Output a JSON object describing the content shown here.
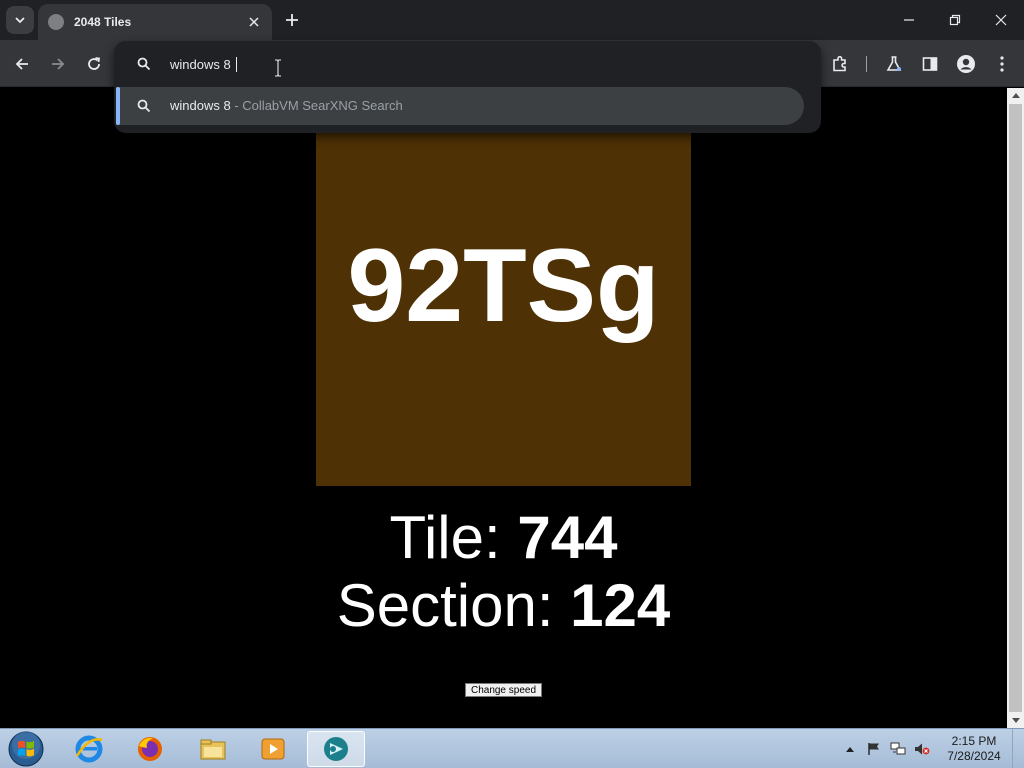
{
  "browser": {
    "tab_title": "2048 Tiles",
    "omnibox_text": "windows 8",
    "suggestion": {
      "query": "windows 8",
      "separator": "-",
      "engine": "CollabVM SearXNG Search"
    }
  },
  "page": {
    "tile_label": "92TSg",
    "tile_color": "#4e3105",
    "tile_prefix": "Tile:",
    "tile_number": "744",
    "section_prefix": "Section:",
    "section_number": "124",
    "speed_button": "Change speed"
  },
  "taskbar": {
    "apps": [
      "internet-explorer-icon",
      "firefox-icon",
      "file-explorer-icon",
      "media-player-icon",
      "collabvm-icon"
    ],
    "clock_time": "2:15 PM",
    "clock_date": "7/28/2024"
  }
}
